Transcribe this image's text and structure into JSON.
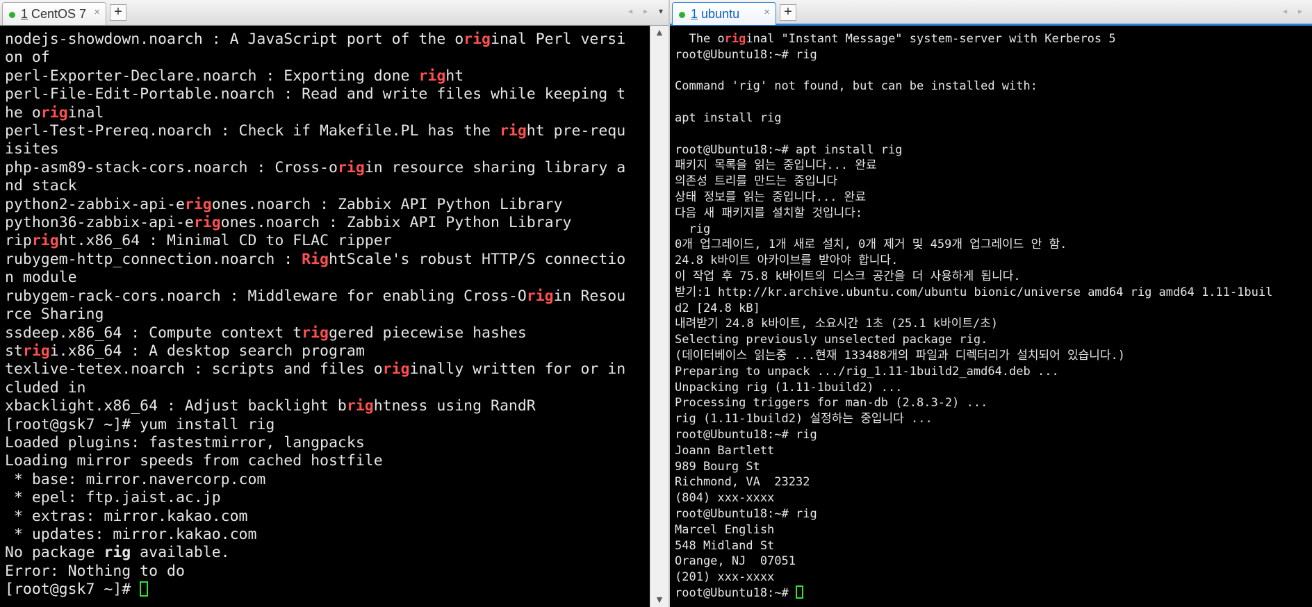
{
  "left": {
    "tab": {
      "number": "1",
      "title": "CentOS 7",
      "close": "×"
    },
    "new_tab": "+",
    "lines": [
      [
        {
          "t": "nodejs-showdown.noarch : A JavaScript port of the o"
        },
        {
          "t": "rig",
          "h": 1
        },
        {
          "t": "inal Perl versi"
        }
      ],
      [
        {
          "t": "on of"
        }
      ],
      [
        {
          "t": "perl-Exporter-Declare.noarch : Exporting done "
        },
        {
          "t": "rig",
          "h": 1
        },
        {
          "t": "ht"
        }
      ],
      [
        {
          "t": "perl-File-Edit-Portable.noarch : Read and write files while keeping t"
        }
      ],
      [
        {
          "t": "he o"
        },
        {
          "t": "rig",
          "h": 1
        },
        {
          "t": "inal"
        }
      ],
      [
        {
          "t": "perl-Test-Prereq.noarch : Check if Makefile.PL has the "
        },
        {
          "t": "rig",
          "h": 1
        },
        {
          "t": "ht pre-requ"
        }
      ],
      [
        {
          "t": "isites"
        }
      ],
      [
        {
          "t": "php-asm89-stack-cors.noarch : Cross-o"
        },
        {
          "t": "rig",
          "h": 1
        },
        {
          "t": "in resource sharing library a"
        }
      ],
      [
        {
          "t": "nd stack"
        }
      ],
      [
        {
          "t": "python2-zabbix-api-e"
        },
        {
          "t": "rig",
          "h": 1
        },
        {
          "t": "ones.noarch : Zabbix API Python Library"
        }
      ],
      [
        {
          "t": "python36-zabbix-api-e"
        },
        {
          "t": "rig",
          "h": 1
        },
        {
          "t": "ones.noarch : Zabbix API Python Library"
        }
      ],
      [
        {
          "t": "rip"
        },
        {
          "t": "rig",
          "h": 1
        },
        {
          "t": "ht.x86_64 : Minimal CD to FLAC ripper"
        }
      ],
      [
        {
          "t": "rubygem-http_connection.noarch : "
        },
        {
          "t": "Rig",
          "h": 1
        },
        {
          "t": "htScale's robust HTTP/S connectio"
        }
      ],
      [
        {
          "t": "n module"
        }
      ],
      [
        {
          "t": "rubygem-rack-cors.noarch : Middleware for enabling Cross-O"
        },
        {
          "t": "rig",
          "h": 1
        },
        {
          "t": "in Resou"
        }
      ],
      [
        {
          "t": "rce Sharing"
        }
      ],
      [
        {
          "t": "ssdeep.x86_64 : Compute context t"
        },
        {
          "t": "rig",
          "h": 1
        },
        {
          "t": "gered piecewise hashes"
        }
      ],
      [
        {
          "t": "st"
        },
        {
          "t": "rig",
          "h": 1
        },
        {
          "t": "i.x86_64 : A desktop search program"
        }
      ],
      [
        {
          "t": "texlive-tetex.noarch : scripts and files o"
        },
        {
          "t": "rig",
          "h": 1
        },
        {
          "t": "inally written for or in"
        }
      ],
      [
        {
          "t": "cluded in"
        }
      ],
      [
        {
          "t": "xbacklight.x86_64 : Adjust backlight b"
        },
        {
          "t": "rig",
          "h": 1
        },
        {
          "t": "htness using RandR"
        }
      ],
      [
        {
          "t": "[root@gsk7 ~]# yum install rig"
        }
      ],
      [
        {
          "t": "Loaded plugins: fastestmirror, langpacks"
        }
      ],
      [
        {
          "t": "Loading mirror speeds from cached hostfile"
        }
      ],
      [
        {
          "t": " * base: mirror.navercorp.com"
        }
      ],
      [
        {
          "t": " * epel: ftp.jaist.ac.jp"
        }
      ],
      [
        {
          "t": " * extras: mirror.kakao.com"
        }
      ],
      [
        {
          "t": " * updates: mirror.kakao.com"
        }
      ],
      [
        {
          "t": "No package "
        },
        {
          "t": "rig",
          "b": 1
        },
        {
          "t": " available."
        }
      ],
      [
        {
          "t": "Error: Nothing to do"
        }
      ],
      [
        {
          "t": "[root@gsk7 ~]# "
        },
        {
          "c": 1
        }
      ]
    ]
  },
  "right": {
    "tab": {
      "number": "1",
      "title": "ubuntu",
      "close": "×"
    },
    "new_tab": "+",
    "lines": [
      [
        {
          "t": "  The o"
        },
        {
          "t": "rig",
          "h": 1
        },
        {
          "t": "inal \"Instant Message\" system-server with Kerberos 5"
        }
      ],
      [
        {
          "t": "root@Ubuntu18:~# rig"
        }
      ],
      [
        {
          "t": ""
        }
      ],
      [
        {
          "t": "Command 'rig' not found, but can be installed with:"
        }
      ],
      [
        {
          "t": ""
        }
      ],
      [
        {
          "t": "apt install rig"
        }
      ],
      [
        {
          "t": ""
        }
      ],
      [
        {
          "t": "root@Ubuntu18:~# apt install rig"
        }
      ],
      [
        {
          "t": "패키지 목록을 읽는 중입니다... 완료"
        }
      ],
      [
        {
          "t": "의존성 트리를 만드는 중입니다"
        }
      ],
      [
        {
          "t": "상태 정보를 읽는 중입니다... 완료"
        }
      ],
      [
        {
          "t": "다음 새 패키지를 설치할 것입니다:"
        }
      ],
      [
        {
          "t": "  rig"
        }
      ],
      [
        {
          "t": "0개 업그레이드, 1개 새로 설치, 0개 제거 및 459개 업그레이드 안 함."
        }
      ],
      [
        {
          "t": "24.8 k바이트 아카이브를 받아야 합니다."
        }
      ],
      [
        {
          "t": "이 작업 후 75.8 k바이트의 디스크 공간을 더 사용하게 됩니다."
        }
      ],
      [
        {
          "t": "받기:1 http://kr.archive.ubuntu.com/ubuntu bionic/universe amd64 rig amd64 1.11-1buil"
        }
      ],
      [
        {
          "t": "d2 [24.8 kB]"
        }
      ],
      [
        {
          "t": "내려받기 24.8 k바이트, 소요시간 1초 (25.1 k바이트/초)"
        }
      ],
      [
        {
          "t": "Selecting previously unselected package rig."
        }
      ],
      [
        {
          "t": "(데이터베이스 읽는중 ...현재 133488개의 파일과 디렉터리가 설치되어 있습니다.)"
        }
      ],
      [
        {
          "t": "Preparing to unpack .../rig_1.11-1build2_amd64.deb ..."
        }
      ],
      [
        {
          "t": "Unpacking rig (1.11-1build2) ..."
        }
      ],
      [
        {
          "t": "Processing triggers for man-db (2.8.3-2) ..."
        }
      ],
      [
        {
          "t": "rig (1.11-1build2) 설정하는 중입니다 ..."
        }
      ],
      [
        {
          "t": "root@Ubuntu18:~# rig"
        }
      ],
      [
        {
          "t": "Joann Bartlett"
        }
      ],
      [
        {
          "t": "989 Bourg St"
        }
      ],
      [
        {
          "t": "Richmond, VA  23232"
        }
      ],
      [
        {
          "t": "(804) xxx-xxxx"
        }
      ],
      [
        {
          "t": "root@Ubuntu18:~# rig"
        }
      ],
      [
        {
          "t": "Marcel English"
        }
      ],
      [
        {
          "t": "548 Midland St"
        }
      ],
      [
        {
          "t": "Orange, NJ  07051"
        }
      ],
      [
        {
          "t": "(201) xxx-xxxx"
        }
      ],
      [
        {
          "t": "root@Ubuntu18:~# "
        },
        {
          "c": 1
        }
      ]
    ]
  },
  "icons": {
    "scroll_up": "▲",
    "scroll_down": "▼",
    "nav": "◂ ▸",
    "menu": "▾"
  },
  "colors": {
    "highlight": "#ff5050",
    "cursor": "#2ee62e",
    "active_tab_accent": "#2f7fd6",
    "status_dot": "#2fb02f"
  }
}
